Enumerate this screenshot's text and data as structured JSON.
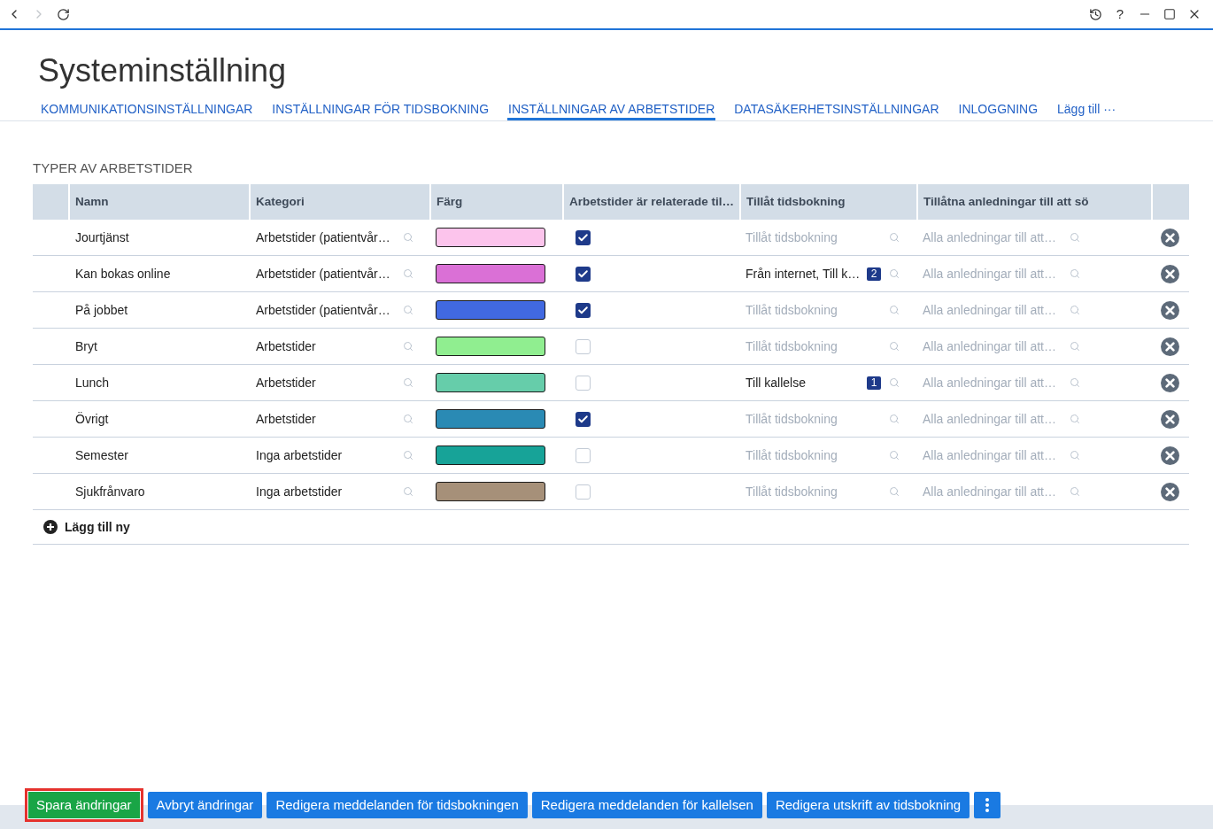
{
  "toolbar": {
    "back": {
      "disabled": false
    },
    "forward": {
      "disabled": true
    },
    "help_label": "?"
  },
  "title": "Systeminställning",
  "tabs": [
    {
      "label": "KOMMUNIKATIONSINSTÄLLNINGAR",
      "selected": false
    },
    {
      "label": "INSTÄLLNINGAR FÖR TIDSBOKNING",
      "selected": false
    },
    {
      "label": "INSTÄLLNINGAR AV ARBETSTIDER",
      "selected": true
    },
    {
      "label": "DATASÄKERHETSINSTÄLLNINGAR",
      "selected": false
    },
    {
      "label": "INLOGGNING",
      "selected": false
    },
    {
      "label": "Lägg till ···",
      "selected": false
    }
  ],
  "section_title": "TYPER AV ARBETSTIDER",
  "table": {
    "columns": [
      "Namn",
      "Kategori",
      "Färg",
      "Arbetstider är relaterade til…",
      "Tillåt tidsbokning",
      "Tillåtna anledningar till att sö"
    ],
    "rows": [
      {
        "name": "Jourtjänst",
        "category": "Arbetstider (patientvår…",
        "color": "#fcc4ec",
        "related": true,
        "booking": {
          "placeholder": "Tillåt tidsbokning"
        },
        "reasons": {
          "placeholder": "Alla anledningar till att…"
        }
      },
      {
        "name": "Kan bokas online",
        "category": "Arbetstider (patientvår…",
        "color": "#da70d6",
        "related": true,
        "booking": {
          "value": "Från internet, Till k…",
          "count": "2"
        },
        "reasons": {
          "placeholder": "Alla anledningar till att…"
        }
      },
      {
        "name": "På jobbet",
        "category": "Arbetstider (patientvår…",
        "color": "#4169e1",
        "related": true,
        "booking": {
          "placeholder": "Tillåt tidsbokning"
        },
        "reasons": {
          "placeholder": "Alla anledningar till att…"
        }
      },
      {
        "name": "Bryt",
        "category": "Arbetstider",
        "color": "#90ee90",
        "related": false,
        "booking": {
          "placeholder": "Tillåt tidsbokning"
        },
        "reasons": {
          "placeholder": "Alla anledningar till att…"
        }
      },
      {
        "name": "Lunch",
        "category": "Arbetstider",
        "color": "#66cdaa",
        "related": false,
        "booking": {
          "value": "Till kallelse",
          "count": "1"
        },
        "reasons": {
          "placeholder": "Alla anledningar till att…"
        }
      },
      {
        "name": "Övrigt",
        "category": "Arbetstider",
        "color": "#2a8ab4",
        "related": true,
        "booking": {
          "placeholder": "Tillåt tidsbokning"
        },
        "reasons": {
          "placeholder": "Alla anledningar till att…"
        }
      },
      {
        "name": "Semester",
        "category": "Inga arbetstider",
        "color": "#17a398",
        "related": false,
        "booking": {
          "placeholder": "Tillåt tidsbokning"
        },
        "reasons": {
          "placeholder": "Alla anledningar till att…"
        }
      },
      {
        "name": "Sjukfrånvaro",
        "category": "Inga arbetstider",
        "color": "#a69079",
        "related": false,
        "booking": {
          "placeholder": "Tillåt tidsbokning"
        },
        "reasons": {
          "placeholder": "Alla anledningar till att…"
        }
      }
    ]
  },
  "add_row_label": "Lägg till ny",
  "footer_buttons": [
    {
      "kind": "save",
      "label": "Spara ändringar",
      "focused": true
    },
    {
      "kind": "normal",
      "label": "Avbryt ändringar",
      "focused": false
    },
    {
      "kind": "normal",
      "label": "Redigera meddelanden för tidsbokningen",
      "focused": false
    },
    {
      "kind": "normal",
      "label": "Redigera meddelanden för kallelsen",
      "focused": false
    },
    {
      "kind": "normal",
      "label": "Redigera utskrift av tidsbokning",
      "focused": false
    },
    {
      "kind": "more",
      "focused": false
    }
  ]
}
